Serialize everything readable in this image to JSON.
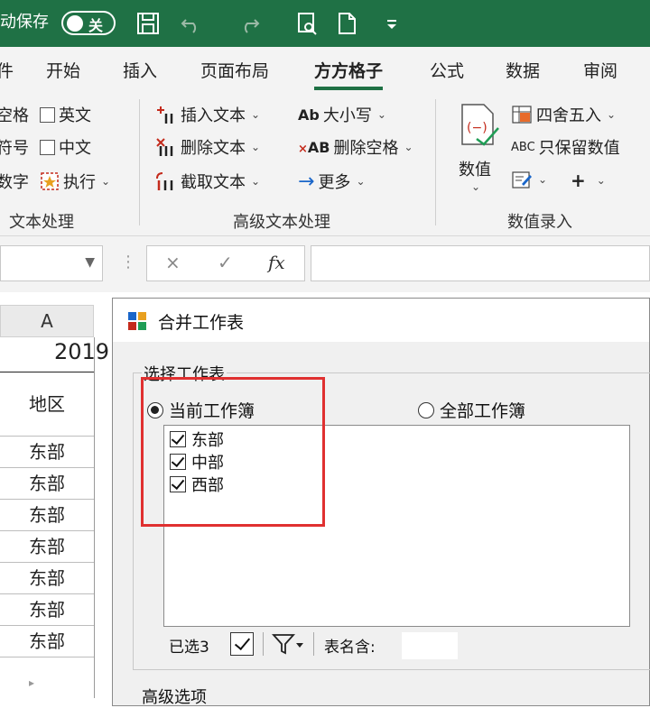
{
  "titlebar": {
    "autosave_label": "动保存",
    "toggle_label": "关",
    "icons": [
      "save-icon",
      "undo-icon",
      "redo-icon",
      "print-preview-icon",
      "new-file-icon",
      "customize-qat-icon"
    ]
  },
  "tabs": [
    "件",
    "开始",
    "插入",
    "页面布局",
    "方方格子",
    "公式",
    "数据",
    "审阅"
  ],
  "active_tab": "方方格子",
  "ribbon": {
    "group1": {
      "items": [
        "空格",
        "符号",
        "数字"
      ],
      "checkboxes": [
        "英文",
        "中文"
      ],
      "execute": "执行",
      "label": "文本处理"
    },
    "group2": {
      "insert_text": "插入文本",
      "delete_text": "删除文本",
      "extract_text": "截取文本",
      "case": "大小写",
      "case_icon": "Ab",
      "delete_space": "删除空格",
      "delete_space_icon": "AB",
      "more": "更多",
      "label": "高级文本处理"
    },
    "group3": {
      "value": "数值",
      "round": "四舍五入",
      "keep_value": "只保留数值",
      "keep_value_icon": "ABC",
      "plus": "+",
      "label": "数值录入"
    }
  },
  "formula_bar": {
    "cancel": "×",
    "confirm": "✓",
    "fx": "fx"
  },
  "sheet": {
    "column_a": "A",
    "year": "2019",
    "header_cell": "地区",
    "rows": [
      "东部",
      "东部",
      "东部",
      "东部",
      "东部",
      "东部",
      "东部"
    ]
  },
  "dialog": {
    "title": "合并工作表",
    "group_label": "选择工作表",
    "radio_current": "当前工作簿",
    "radio_all": "全部工作簿",
    "radio_selected": "current",
    "sheets": [
      "东部",
      "中部",
      "西部"
    ],
    "selected_count": "已选3",
    "name_contains": "表名含:",
    "advanced": "高级选项"
  },
  "colors": {
    "excel_green": "#1f7145",
    "highlight_red": "#e03030"
  }
}
